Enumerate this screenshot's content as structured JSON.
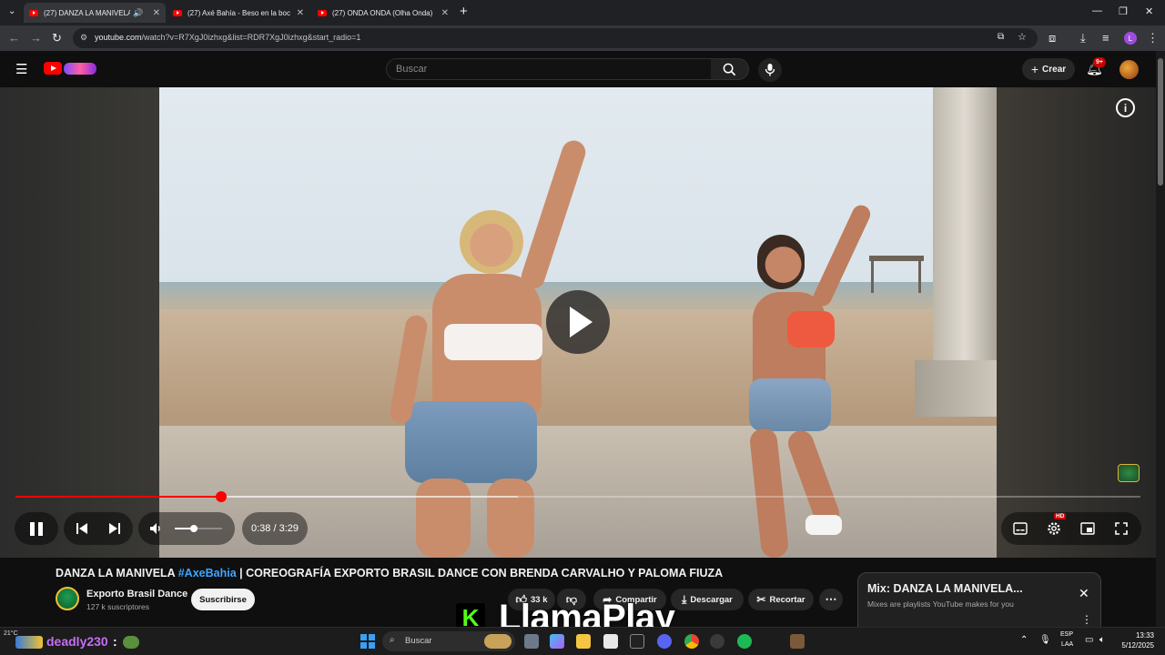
{
  "browser": {
    "tabs": [
      {
        "title": "(27) DANZA LA MANIVELA",
        "active": true,
        "audio": true
      },
      {
        "title": "(27) Axé Bahía - Beso en la boc",
        "active": false
      },
      {
        "title": "(27) ONDA ONDA (Olha Onda)",
        "active": false
      }
    ],
    "url_host": "youtube.com",
    "url_path": "/watch?v=R7XgJ0izhxg&list=RDR7XgJ0izhxg&start_radio=1",
    "profile_letter": "L"
  },
  "youtube": {
    "search_placeholder": "Buscar",
    "create_label": "Crear",
    "notification_count": "9+"
  },
  "player": {
    "progress_fraction": 0.183,
    "buffered_fraction": 0.447,
    "time_display": "0:38 / 3:29",
    "volume_fraction": 0.4,
    "quality_badge": "HD",
    "paused_overlay": true,
    "watermark": "EXPORTO BRASIL"
  },
  "video": {
    "title_before": "DANZA LA MANIVELA ",
    "hashtag": "#AxeBahia",
    "title_after": " | COREOGRAFÍA EXPORTO BRASIL DANCE CON BRENDA CARVALHO Y PALOMA FIUZA",
    "channel_name": "Exporto Brasil Dance",
    "subscribers": "127 k suscriptores",
    "subscribe_label": "Suscribirse",
    "likes": "33 k",
    "share_label": "Compartir",
    "download_label": "Descargar",
    "clip_label": "Recortar"
  },
  "mix": {
    "title": "Mix: DANZA LA MANIVELA...",
    "subtitle": "Mixes are playlists YouTube makes for you"
  },
  "overlay": {
    "brand": "LlamaPlay",
    "k_letter": "K",
    "kick_user": "deadly230",
    "colon": ":"
  },
  "taskbar": {
    "search_label": "Buscar",
    "weather": "21°C",
    "lang_top": "ESP",
    "lang_bottom": "LAA",
    "time": "13:33",
    "date": "5/12/2025"
  },
  "colors": {
    "yt_red": "#ff0000",
    "link_blue": "#3ea6ff",
    "kick_green": "#53fc18"
  }
}
